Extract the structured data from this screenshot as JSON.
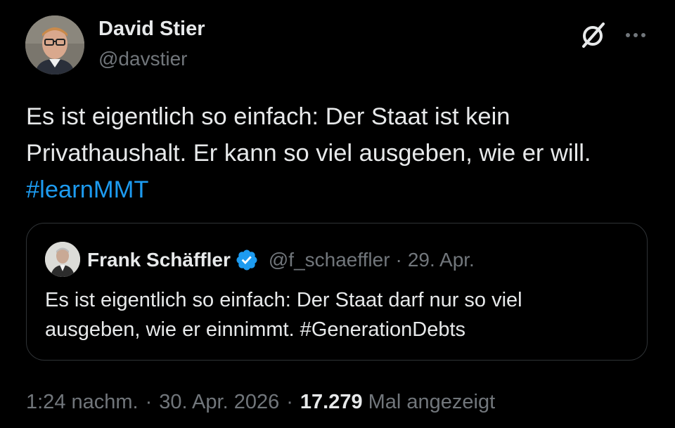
{
  "author": {
    "name": "David Stier",
    "handle": "@davstier"
  },
  "header_icons": [
    "grok-icon",
    "more-options-icon"
  ],
  "tweet": {
    "line1": "Es ist eigentlich so einfach: Der Staat ist kein",
    "line2": "Privathaushalt. Er kann so viel ausgeben, wie er will.",
    "hashtag": "#learnMMT"
  },
  "quoted_tweet": {
    "author_name": "Frank Schäffler",
    "verified": true,
    "handle": "@f_schaeffler",
    "separator": "·",
    "date": "29. Apr.",
    "line1": "Es ist eigentlich so einfach: Der Staat darf nur so viel",
    "line2": "ausgeben, wie er einnimmt. #GenerationDebts"
  },
  "meta": {
    "time": "1:24 nachm.",
    "separator": "·",
    "date": "30. Apr. 2026",
    "views_count": "17.279",
    "views_label": "Mal angezeigt"
  },
  "colors": {
    "background": "#000000",
    "text_primary": "#e7e9ea",
    "text_secondary": "#71767b",
    "link": "#1d9bf0",
    "border": "#2f3336",
    "verified_badge": "#1d9bf0"
  }
}
